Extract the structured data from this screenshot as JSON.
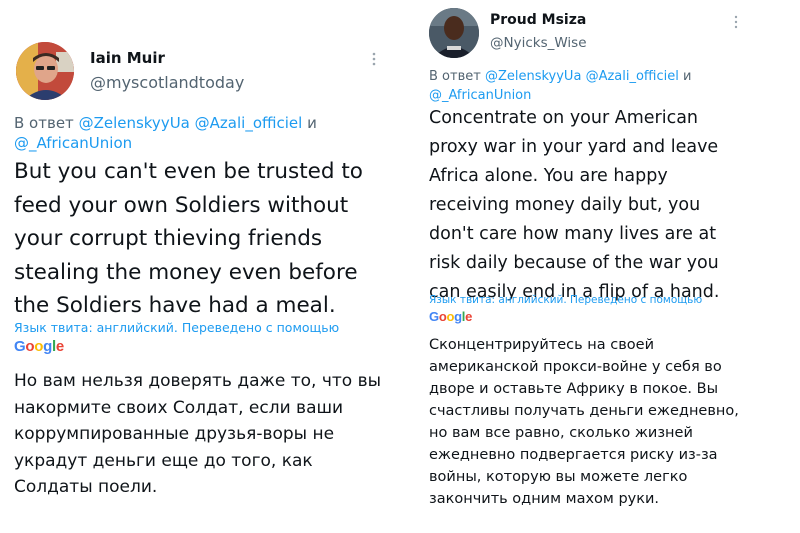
{
  "left_tweet": {
    "author_name": "Iain Muir",
    "author_handle": "@myscotlandtoday",
    "reply_prefix": "В ответ",
    "mention_1": "@ZelenskyyUa",
    "mention_2": "@Azali_officiel",
    "reply_and": "и",
    "mention_3": "@_AfricanUnion",
    "text": "But you can't even be trusted to feed your own Soldiers without your corrupt thieving friends stealing the money even before the Soldiers have had a meal.",
    "translated_label": "Язык твита: английский. Переведено с помощью",
    "google_logo": "Google",
    "translation": "Но вам нельзя доверять даже то, что вы накормите своих Солдат, если ваши коррумпированные друзья-воры не украдут деньги еще до того, как Солдаты поели."
  },
  "right_tweet": {
    "author_name": "Proud Msiza",
    "author_handle": "@Nyicks_Wise",
    "reply_prefix": "В ответ",
    "mention_1": "@ZelenskyyUa",
    "mention_2": "@Azali_officiel",
    "reply_and": "и",
    "mention_3": "@_AfricanUnion",
    "text": "Concentrate on your American proxy war in your yard and leave Africa alone. You are happy receiving money daily but, you don't care how many lives are at risk daily because of the war you can easily end in a flip of a hand.",
    "translated_label": "Язык твита: английский. Переведено с помощью",
    "google_logo": "Google",
    "translation": "Сконцентрируйтесь на своей американской прокси-войне у себя во дворе и оставьте Африку в покое. Вы счастливы получать деньги ежедневно, но вам все равно, сколько жизней ежедневно подвергается риску из-за войны, которую вы можете легко закончить одним махом руки."
  },
  "icons": {
    "more": "more-options-icon",
    "google": "google-logo"
  },
  "colors": {
    "link": "#1d9bf0",
    "secondary": "#536471",
    "text": "#0f1419"
  }
}
